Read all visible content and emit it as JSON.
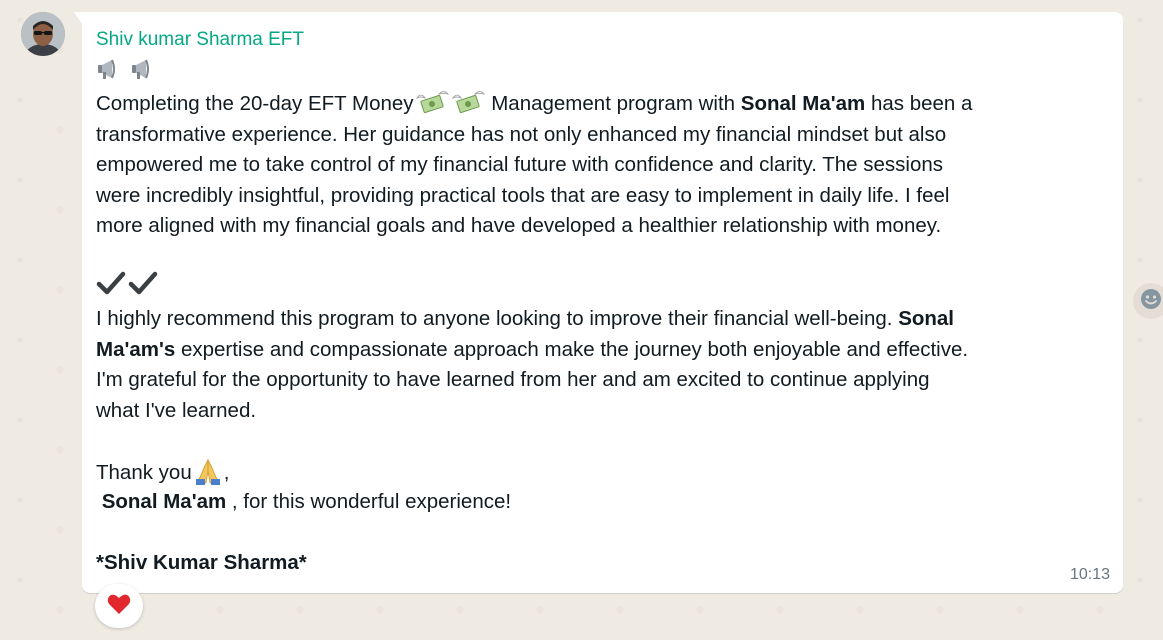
{
  "message": {
    "sender": "Shiv kumar Sharma EFT",
    "para1": {
      "l1_a": "Completing the 20-day EFT Money",
      "l1_b": " Management program with ",
      "l1_bold": "Sonal Ma'am",
      "l1_c": " has been a",
      "l2": "transformative experience. Her guidance has not only enhanced my financial mindset but also",
      "l3": "empowered me to take control of my financial future with confidence and clarity. The sessions",
      "l4": "were incredibly insightful, providing practical tools that are easy to implement in daily life. I feel",
      "l5": "more aligned with my financial goals and have developed a healthier relationship with money."
    },
    "para2": {
      "l1_a": "I highly recommend this program to anyone looking to improve their financial well-being. ",
      "l1_bold": "Sonal",
      "l2_bold": "Ma'am's",
      "l2_a": " expertise and compassionate approach make the journey both enjoyable and effective.",
      "l3": "I'm grateful for the opportunity to have learned from her and am excited to continue applying",
      "l4": "what I've learned."
    },
    "closing": {
      "thanks": "Thank you",
      "comma": ",",
      "name_bold": "Sonal Ma'am",
      "rest": " , for this wonderful experience!"
    },
    "signature": "*Shiv Kumar Sharma*",
    "time": "10:13"
  },
  "icons": {
    "megaphone": "megaphone-icon",
    "money_wings": "money-with-wings-icon",
    "checkmark": "heavy-check-mark-icon",
    "pray": "folded-hands-icon",
    "reaction": "red-heart-icon",
    "emoji_button": "smiley-icon"
  },
  "colors": {
    "sender_name": "#06a884",
    "bubble": "#ffffff",
    "background": "#efeae2",
    "timestamp": "#667781"
  }
}
